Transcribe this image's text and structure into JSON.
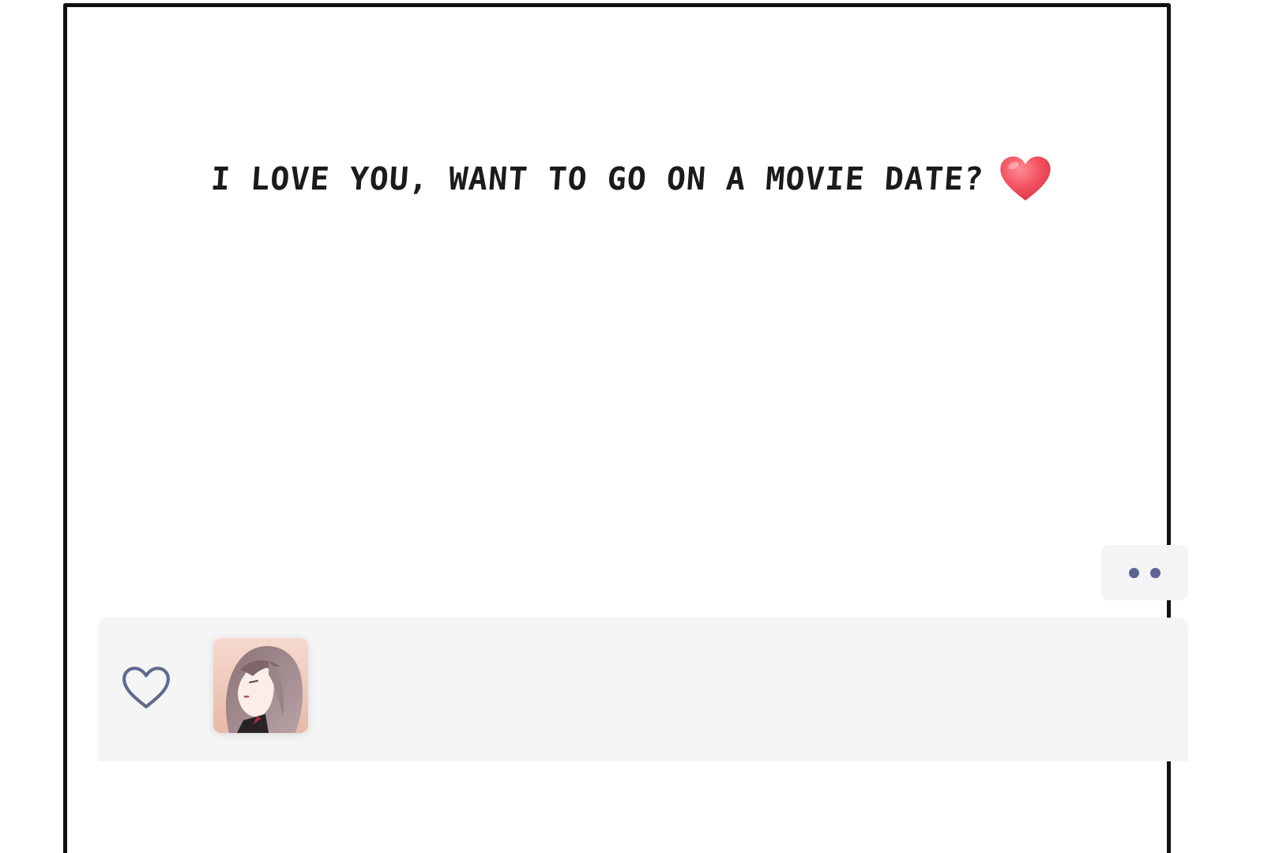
{
  "message": {
    "text": "I LOVE YOU, WANT TO GO ON A MOVIE DATE?",
    "emoji": "red-heart-icon"
  },
  "more_button": {
    "icon": "more-dots-icon",
    "dot_color": "#5e6390"
  },
  "bottom_bar": {
    "like_icon": "heart-outline-icon",
    "avatar_icon": "character-avatar",
    "background": "#f5f5f5"
  },
  "colors": {
    "text": "#1b1b1b",
    "heart": "#ef4f5f",
    "frame": "#111111"
  }
}
